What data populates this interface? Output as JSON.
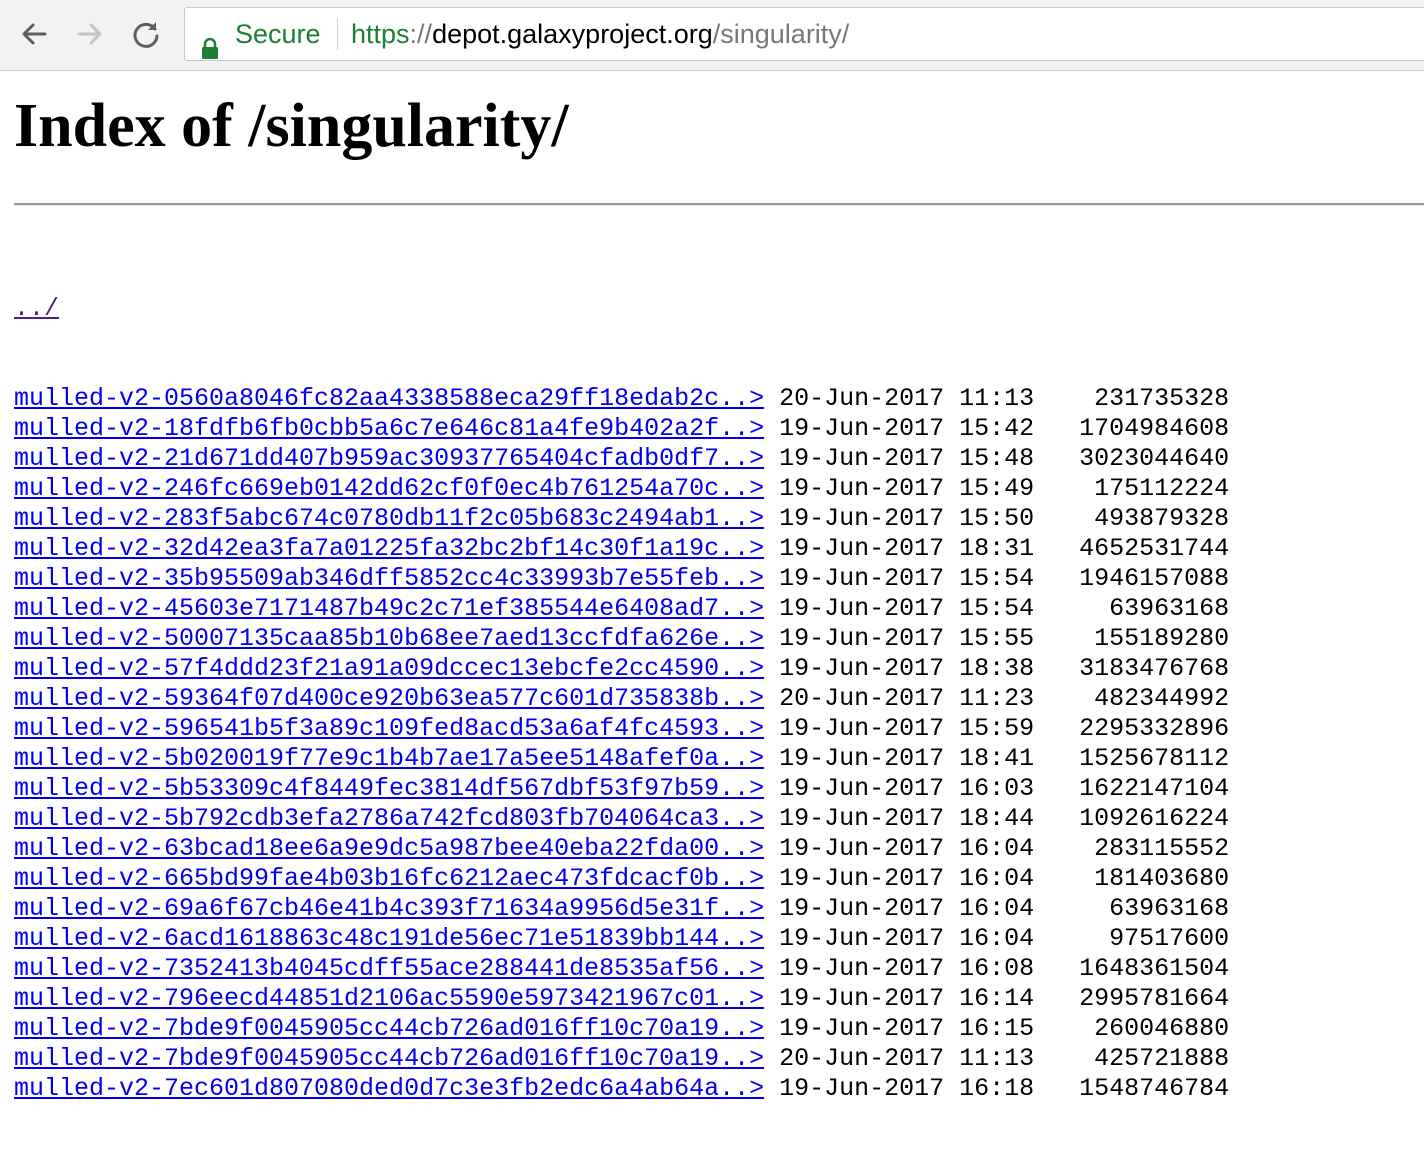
{
  "browser": {
    "secure_label": "Secure",
    "url_scheme": "https",
    "url_colon": "://",
    "url_host": "depot.galaxyproject.org",
    "url_path": "/singularity/",
    "colors": {
      "secure_green": "#1e7e34",
      "link_blue": "#0000ee",
      "visited_purple": "#551a8b"
    },
    "icons": [
      "back-arrow-icon",
      "forward-arrow-icon",
      "reload-icon",
      "lock-icon"
    ]
  },
  "page": {
    "title": "Index of /singularity/",
    "parent_link": "../",
    "entries": [
      {
        "name": "mulled-v2-0560a8046fc82aa4338588eca29ff18edab2c..>",
        "date": "20-Jun-2017 11:13",
        "size": "231735328"
      },
      {
        "name": "mulled-v2-18fdfb6fb0cbb5a6c7e646c81a4fe9b402a2f..>",
        "date": "19-Jun-2017 15:42",
        "size": "1704984608"
      },
      {
        "name": "mulled-v2-21d671dd407b959ac30937765404cfadb0df7..>",
        "date": "19-Jun-2017 15:48",
        "size": "3023044640"
      },
      {
        "name": "mulled-v2-246fc669eb0142dd62cf0f0ec4b761254a70c..>",
        "date": "19-Jun-2017 15:49",
        "size": "175112224"
      },
      {
        "name": "mulled-v2-283f5abc674c0780db11f2c05b683c2494ab1..>",
        "date": "19-Jun-2017 15:50",
        "size": "493879328"
      },
      {
        "name": "mulled-v2-32d42ea3fa7a01225fa32bc2bf14c30f1a19c..>",
        "date": "19-Jun-2017 18:31",
        "size": "4652531744"
      },
      {
        "name": "mulled-v2-35b95509ab346dff5852cc4c33993b7e55feb..>",
        "date": "19-Jun-2017 15:54",
        "size": "1946157088"
      },
      {
        "name": "mulled-v2-45603e7171487b49c2c71ef385544e6408ad7..>",
        "date": "19-Jun-2017 15:54",
        "size": "63963168"
      },
      {
        "name": "mulled-v2-50007135caa85b10b68ee7aed13ccfdfa626e..>",
        "date": "19-Jun-2017 15:55",
        "size": "155189280"
      },
      {
        "name": "mulled-v2-57f4ddd23f21a91a09dccec13ebcfe2cc4590..>",
        "date": "19-Jun-2017 18:38",
        "size": "3183476768"
      },
      {
        "name": "mulled-v2-59364f07d400ce920b63ea577c601d735838b..>",
        "date": "20-Jun-2017 11:23",
        "size": "482344992"
      },
      {
        "name": "mulled-v2-596541b5f3a89c109fed8acd53a6af4fc4593..>",
        "date": "19-Jun-2017 15:59",
        "size": "2295332896"
      },
      {
        "name": "mulled-v2-5b020019f77e9c1b4b7ae17a5ee5148afef0a..>",
        "date": "19-Jun-2017 18:41",
        "size": "1525678112"
      },
      {
        "name": "mulled-v2-5b53309c4f8449fec3814df567dbf53f97b59..>",
        "date": "19-Jun-2017 16:03",
        "size": "1622147104"
      },
      {
        "name": "mulled-v2-5b792cdb3efa2786a742fcd803fb704064ca3..>",
        "date": "19-Jun-2017 18:44",
        "size": "1092616224"
      },
      {
        "name": "mulled-v2-63bcad18ee6a9e9dc5a987bee40eba22fda00..>",
        "date": "19-Jun-2017 16:04",
        "size": "283115552"
      },
      {
        "name": "mulled-v2-665bd99fae4b03b16fc6212aec473fdcacf0b..>",
        "date": "19-Jun-2017 16:04",
        "size": "181403680"
      },
      {
        "name": "mulled-v2-69a6f67cb46e41b4c393f71634a9956d5e31f..>",
        "date": "19-Jun-2017 16:04",
        "size": "63963168"
      },
      {
        "name": "mulled-v2-6acd1618863c48c191de56ec71e51839bb144..>",
        "date": "19-Jun-2017 16:04",
        "size": "97517600"
      },
      {
        "name": "mulled-v2-7352413b4045cdff55ace288441de8535af56..>",
        "date": "19-Jun-2017 16:08",
        "size": "1648361504"
      },
      {
        "name": "mulled-v2-796eecd44851d2106ac5590e5973421967c01..>",
        "date": "19-Jun-2017 16:14",
        "size": "2995781664"
      },
      {
        "name": "mulled-v2-7bde9f0045905cc44cb726ad016ff10c70a19..>",
        "date": "19-Jun-2017 16:15",
        "size": "260046880"
      },
      {
        "name": "mulled-v2-7bde9f0045905cc44cb726ad016ff10c70a19..>",
        "date": "20-Jun-2017 11:13",
        "size": "425721888"
      },
      {
        "name": "mulled-v2-7ec601d807080ded0d7c3e3fb2edc6a4ab64a..>",
        "date": "19-Jun-2017 16:18",
        "size": "1548746784"
      }
    ]
  }
}
